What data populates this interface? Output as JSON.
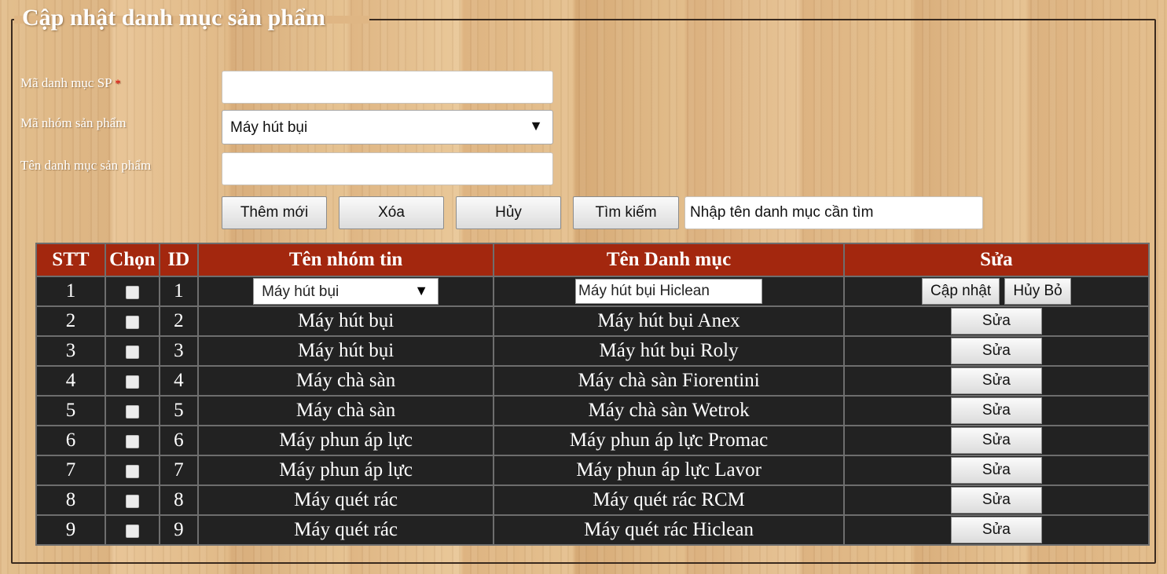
{
  "form": {
    "legend": "Cập nhật danh mục sản phẩm",
    "ma_danh_muc_label": "Mã danh mục SP",
    "required_mark": "*",
    "ma_danh_muc_value": "",
    "ma_nhom_label": "Mã nhóm sản phẩm",
    "ma_nhom_selected": "Máy hút bụi",
    "ten_danh_muc_label": "Tên danh mục sản phẩm",
    "ten_danh_muc_value": ""
  },
  "actions": {
    "them_moi": "Thêm mới",
    "xoa": "Xóa",
    "huy": "Hủy",
    "tim_kiem": "Tìm kiếm",
    "search_value": "Nhập tên danh mục cần tìm"
  },
  "table": {
    "headers": [
      "STT",
      "Chọn",
      "ID",
      "Tên nhóm tin",
      "Tên Danh mục",
      "Sửa"
    ],
    "edit_row": {
      "stt": "1",
      "id": "1",
      "nhom_selected": "Máy hút bụi",
      "danh_muc_value": "Máy hút bụi Hiclean",
      "cap_nhat": "Cập nhật",
      "huy_bo": "Hủy Bỏ"
    },
    "sua_label": "Sửa",
    "rows": [
      {
        "stt": "2",
        "id": "2",
        "nhom": "Máy hút bụi",
        "danh_muc": "Máy hút bụi Anex"
      },
      {
        "stt": "3",
        "id": "3",
        "nhom": "Máy hút bụi",
        "danh_muc": "Máy hút bụi Roly"
      },
      {
        "stt": "4",
        "id": "4",
        "nhom": "Máy chà sàn",
        "danh_muc": "Máy chà sàn Fiorentini"
      },
      {
        "stt": "5",
        "id": "5",
        "nhom": "Máy chà sàn",
        "danh_muc": "Máy chà sàn Wetrok"
      },
      {
        "stt": "6",
        "id": "6",
        "nhom": "Máy phun áp lực",
        "danh_muc": "Máy phun áp lực Promac"
      },
      {
        "stt": "7",
        "id": "7",
        "nhom": "Máy phun áp lực",
        "danh_muc": "Máy phun áp lực Lavor"
      },
      {
        "stt": "8",
        "id": "8",
        "nhom": "Máy quét rác",
        "danh_muc": "Máy quét rác RCM"
      },
      {
        "stt": "9",
        "id": "9",
        "nhom": "Máy quét rác",
        "danh_muc": "Máy quét rác Hiclean"
      }
    ]
  },
  "colors": {
    "header_bg": "#a3270e",
    "table_bg": "#222222",
    "required": "#e00000"
  }
}
